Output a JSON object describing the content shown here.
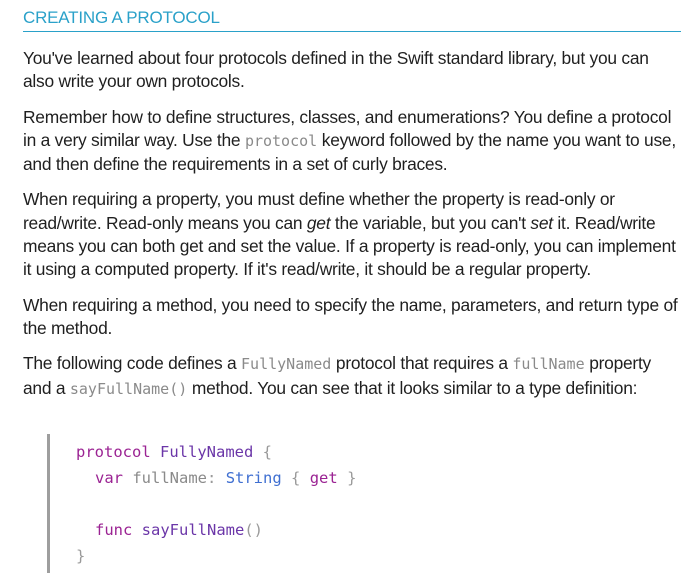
{
  "section": {
    "title": "CREATING A PROTOCOL"
  },
  "paragraphs": {
    "p1": "You've learned about four protocols defined in the Swift standard library, but you can also write your own protocols.",
    "p2": {
      "before": "Remember how to define structures, classes, and enumerations? You define a protocol in a very similar way. Use the ",
      "code": "protocol",
      "after": " keyword followed by the name you want to use, and then define the requirements in a set of curly braces."
    },
    "p3": {
      "part1": "When requiring a property, you must define whether the property is read-only or read/write. Read-only means you can ",
      "em1": "get",
      "part2": " the variable, but you can't ",
      "em2": "set",
      "part3": " it. Read/write means you can both get and set the value. If a property is read-only, you can implement it using a computed property. If it's read/write, it should be a regular property."
    },
    "p4": "When requiring a method, you need to specify the name, parameters, and return type of the method.",
    "p5": {
      "part1": "The following code defines a ",
      "code1": "FullyNamed",
      "part2": " protocol that requires a ",
      "code2": "fullName",
      "part3": " property and a ",
      "code3": "sayFullName()",
      "part4": " method. You can see that it looks similar to a type definition:"
    }
  },
  "code": {
    "line1": {
      "kw": "protocol",
      "name": "FullyNamed",
      "brace": "{"
    },
    "line2": {
      "kw": "var",
      "name": "fullName",
      "colon": ":",
      "type": "String",
      "open": "{",
      "get": "get",
      "close": "}"
    },
    "line3": {
      "kw": "func",
      "name": "sayFullName",
      "parens": "()"
    },
    "line4": {
      "brace": "}"
    }
  }
}
